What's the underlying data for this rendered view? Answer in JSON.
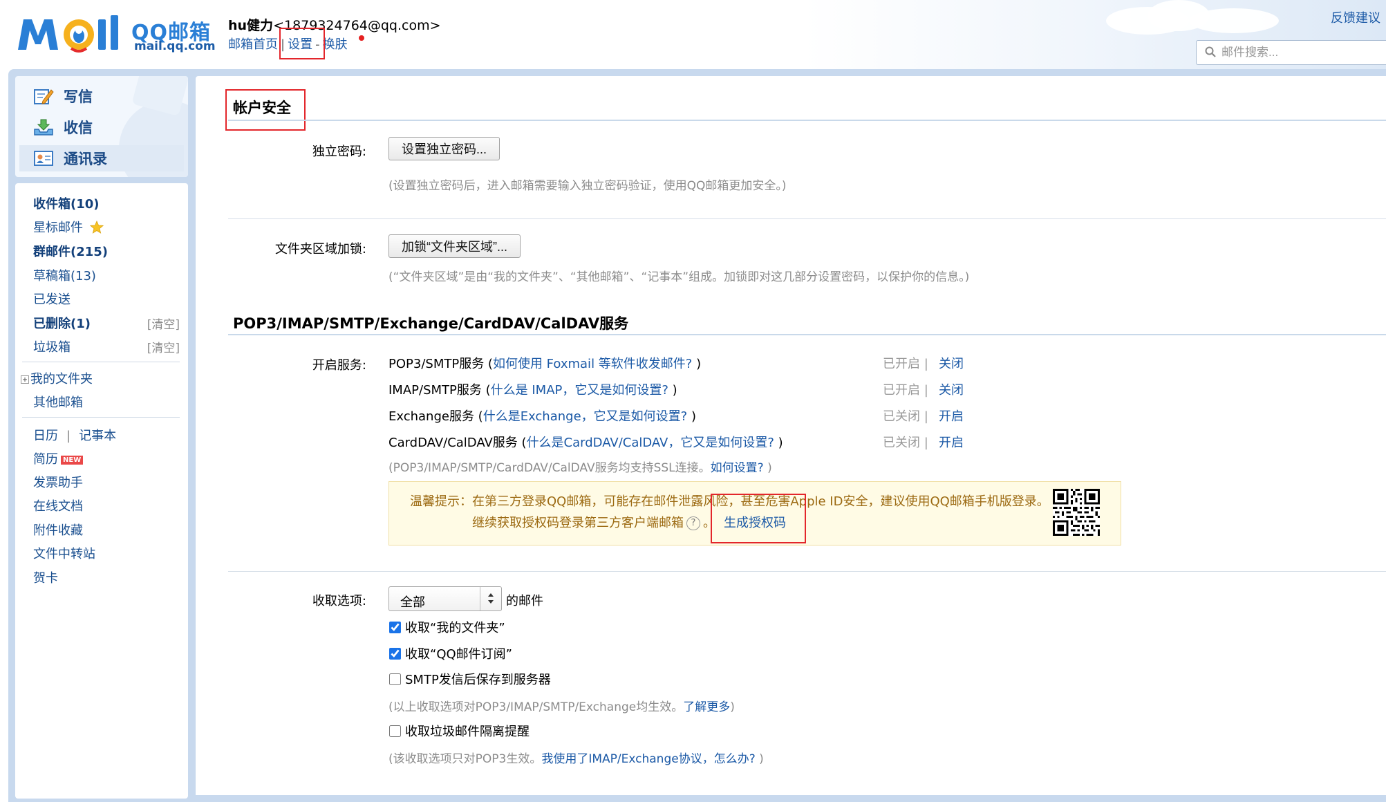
{
  "header": {
    "logo_text": "QQ邮箱",
    "logo_domain": "mail.qq.com",
    "user_name": "hu健力",
    "user_email": "<1879324764@qq.com>",
    "links": {
      "home": "邮箱首页",
      "sep1": "|",
      "settings": "设置",
      "sep2": "-",
      "skin": "换肤"
    },
    "feedback": "反馈建议",
    "search_placeholder": "邮件搜索..."
  },
  "sidebar": {
    "actions": {
      "compose": "写信",
      "receive": "收信",
      "contacts": "通讯录"
    },
    "folders": {
      "inbox": "收件箱(10)",
      "starred": "星标邮件",
      "group": "群邮件(215)",
      "drafts": "草稿箱(13)",
      "sent": "已发送",
      "deleted": "已删除(1)",
      "trash": "垃圾箱",
      "clear": "[清空]",
      "my_folders": "我的文件夹",
      "other_mail": "其他邮箱",
      "calendar": "日历",
      "cal_sep": "|",
      "notes": "记事本",
      "resume": "简历",
      "new_badge": "NEW",
      "invoice": "发票助手",
      "docs": "在线文档",
      "attachments": "附件收藏",
      "transfer": "文件中转站",
      "cards": "贺卡"
    }
  },
  "main": {
    "security": {
      "title": "帐户安全",
      "independent_pwd_label": "独立密码:",
      "independent_pwd_button": "设置独立密码...",
      "independent_pwd_note": "(设置独立密码后，进入邮箱需要输入独立密码验证，使用QQ邮箱更加安全。)",
      "folder_lock_label": "文件夹区域加锁:",
      "folder_lock_button": "加锁“文件夹区域”...",
      "folder_lock_note": "(“文件夹区域”是由“我的文件夹”、“其他邮箱”、“记事本”组成。加锁即对这几部分设置密码，以保护你的信息。)"
    },
    "services": {
      "title": "POP3/IMAP/SMTP/Exchange/CardDAV/CalDAV服务",
      "enable_label": "开启服务:",
      "items": [
        {
          "name": "POP3/SMTP服务",
          "open": " (",
          "link": "如何使用 Foxmail 等软件收发邮件?",
          "close": " )",
          "status": "已开启",
          "sep": "|",
          "toggle": "关闭"
        },
        {
          "name": "IMAP/SMTP服务",
          "open": " (",
          "link": "什么是 IMAP，它又是如何设置?",
          "close": " )",
          "status": "已开启",
          "sep": "|",
          "toggle": "关闭"
        },
        {
          "name": "Exchange服务",
          "open": " (",
          "link": "什么是Exchange，它又是如何设置?",
          "close": " )",
          "status": "已关闭",
          "sep": "|",
          "toggle": "开启"
        },
        {
          "name": "CardDAV/CalDAV服务",
          "open": " (",
          "link": "什么是CardDAV/CalDAV，它又是如何设置?",
          "close": " )",
          "status": "已关闭",
          "sep": "|",
          "toggle": "开启"
        }
      ],
      "ssl_note": "(POP3/IMAP/SMTP/CardDAV/CalDAV服务均支持SSL连接。",
      "ssl_link": "如何设置?",
      "ssl_close": " )",
      "tip_line1": "温馨提示：在第三方登录QQ邮箱，可能存在邮件泄露风险，甚至危害Apple ID安全，建议使用QQ邮箱手机版登录。",
      "tip_line2": "继续获取授权码登录第三方客户端邮箱",
      "tip_help": "?",
      "tip_period": "。",
      "generate_code": "生成授权码"
    },
    "receive_options": {
      "label": "收取选项:",
      "select_value": "全部",
      "suffix": "的邮件",
      "opt1": "收取“我的文件夹”",
      "opt2": "收取“QQ邮件订阅”",
      "opt3": "SMTP发信后保存到服务器",
      "note1": "(以上收取选项对POP3/IMAP/SMTP/Exchange均生效。",
      "note1_link": "了解更多",
      "note1_close": ")",
      "opt4": "收取垃圾邮件隔离提醒",
      "note2": "(该收取选项只对POP3生效。",
      "note2_link": "我使用了IMAP/Exchange协议，怎么办?",
      "note2_close": " )"
    }
  },
  "colors": {
    "link": "#1b59a6",
    "highlight_box": "#e3262b",
    "frame": "#c8d9ee"
  }
}
